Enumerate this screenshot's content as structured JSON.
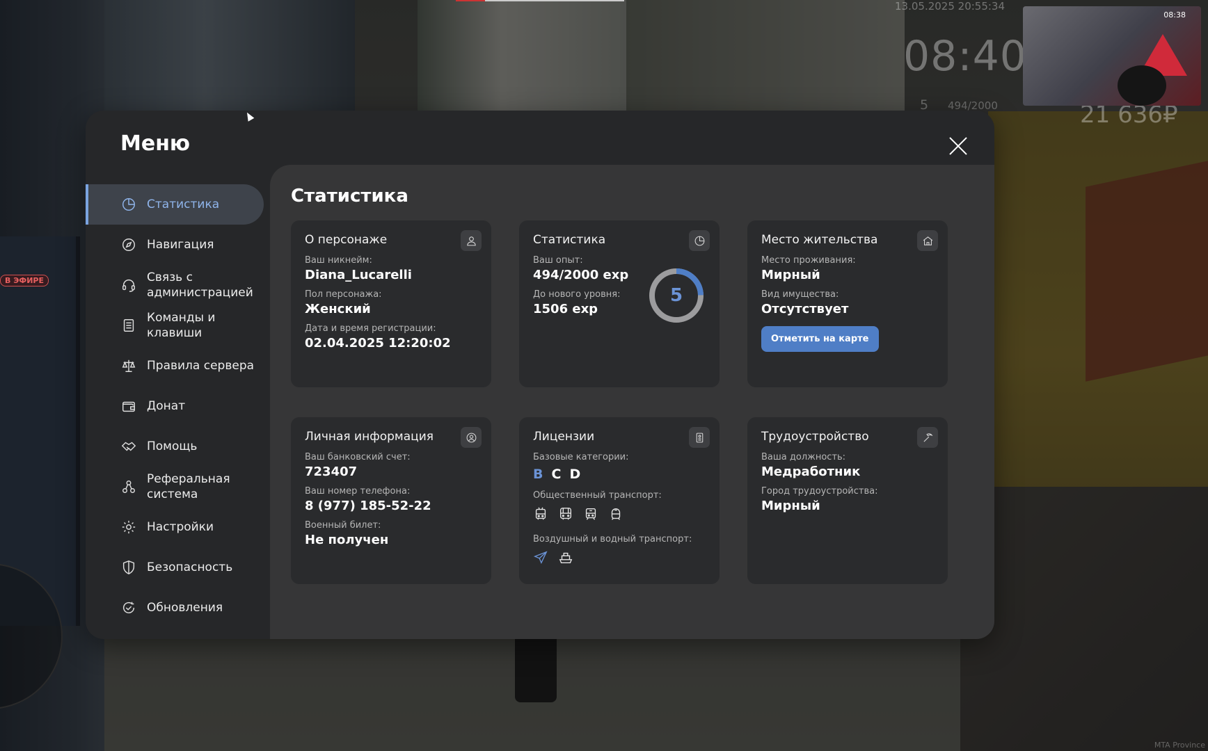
{
  "hud": {
    "datetime": "13.05.2025 20:55:34",
    "time": "08:40",
    "level": "5",
    "exp": "494/2000",
    "money": "21 636₽",
    "on_air": "В ЭФИРЕ",
    "minimap_time": "08:38",
    "server": "MTA Province"
  },
  "menu": {
    "title": "Меню",
    "close_icon": "close-icon"
  },
  "sidebar": {
    "items": [
      {
        "label": "Статистика",
        "icon": "pie-chart-icon",
        "active": true
      },
      {
        "label": "Навигация",
        "icon": "compass-icon"
      },
      {
        "label": "Связь с администрацией",
        "icon": "headset-icon"
      },
      {
        "label": "Команды и клавиши",
        "icon": "document-icon"
      },
      {
        "label": "Правила сервера",
        "icon": "scales-icon"
      },
      {
        "label": "Донат",
        "icon": "wallet-icon"
      },
      {
        "label": "Помощь",
        "icon": "handshake-icon"
      },
      {
        "label": "Реферальная система",
        "icon": "network-icon"
      },
      {
        "label": "Настройки",
        "icon": "gear-icon"
      },
      {
        "label": "Безопасность",
        "icon": "shield-icon"
      },
      {
        "label": "Обновления",
        "icon": "refresh-check-icon"
      }
    ]
  },
  "content": {
    "title": "Статистика",
    "about": {
      "title": "О персонаже",
      "nick_label": "Ваш никнейм:",
      "nick": "Diana_Lucarelli",
      "gender_label": "Пол персонажа:",
      "gender": "Женский",
      "reg_label": "Дата и время регистрации:",
      "reg": "02.04.2025 12:20:02"
    },
    "stats": {
      "title": "Статистика",
      "exp_label": "Ваш опыт:",
      "exp": "494/2000 exp",
      "next_label": "До нового уровня:",
      "next": "1506 exp",
      "level": "5",
      "progress": 0.247
    },
    "residence": {
      "title": "Место жительства",
      "place_label": "Место проживания:",
      "place": "Мирный",
      "property_label": "Вид имущества:",
      "property": "Отсутствует",
      "button": "Отметить на карте"
    },
    "personal": {
      "title": "Личная информация",
      "bank_label": "Ваш банковский счет:",
      "bank": "723407",
      "phone_label": "Ваш номер телефона:",
      "phone": "8 (977) 185-52-22",
      "military_label": "Военный билет:",
      "military": "Не получен"
    },
    "licenses": {
      "title": "Лицензии",
      "base_label": "Базовые категории:",
      "categories": [
        {
          "code": "B",
          "active": true
        },
        {
          "code": "C",
          "active": false
        },
        {
          "code": "D",
          "active": false
        }
      ],
      "public_label": "Общественный транспорт:",
      "public_icons": [
        "trolleybus-icon",
        "bus-icon",
        "tram-icon",
        "train-icon"
      ],
      "air_label": "Воздушный и водный транспорт:",
      "air_icons": [
        "plane-icon",
        "boat-icon"
      ]
    },
    "job": {
      "title": "Трудоустройство",
      "position_label": "Ваша должность:",
      "position": "Медработник",
      "city_label": "Город трудоустройства:",
      "city": "Мирный"
    }
  },
  "colors": {
    "accent": "#6b93d6",
    "button": "#4f7ec6",
    "panel": "#262729",
    "content": "#363637",
    "card": "#2a2b2d"
  }
}
